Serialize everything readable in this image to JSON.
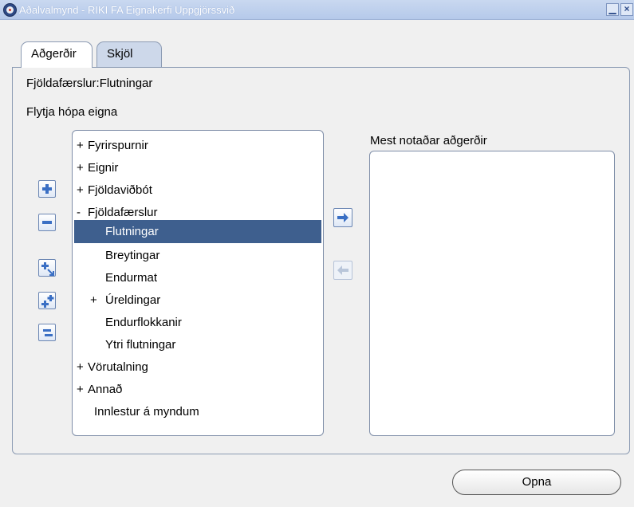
{
  "window": {
    "title": "Aðalvalmynd - RIKI FA Eignakerfi Uppgjörssvið",
    "minimize_glyph": "▁",
    "close_glyph": "×"
  },
  "tabs": [
    {
      "label": "Aðgerðir",
      "active": true
    },
    {
      "label": "Skjöl",
      "active": false
    }
  ],
  "path_label": "Fjöldafærslur:Flutningar",
  "section_label": "Flytja hópa eigna",
  "tree": {
    "items": [
      {
        "expander": "+",
        "label": "Fyrirspurnir",
        "level": 0
      },
      {
        "expander": "+",
        "label": "Eignir",
        "level": 0
      },
      {
        "expander": "+",
        "label": "Fjöldaviðbót",
        "level": 0
      },
      {
        "expander": "-",
        "label": "Fjöldafærslur",
        "level": 0
      },
      {
        "expander": "",
        "label": "Flutningar",
        "level": 1,
        "selected": true
      },
      {
        "expander": "",
        "label": "Breytingar",
        "level": 1
      },
      {
        "expander": "",
        "label": "Endurmat",
        "level": 1
      },
      {
        "expander": "+",
        "label": "Úreldingar",
        "level": 1
      },
      {
        "expander": "",
        "label": "Endurflokkanir",
        "level": 1
      },
      {
        "expander": "",
        "label": "Ytri flutningar",
        "level": 1
      },
      {
        "expander": "+",
        "label": "Vörutalning",
        "level": 0
      },
      {
        "expander": "+",
        "label": "Annað",
        "level": 0
      },
      {
        "expander": "",
        "label": "Innlestur á myndum",
        "level": 0
      }
    ]
  },
  "favorites": {
    "label": "Mest notaðar aðgerðir",
    "items": []
  },
  "buttons": {
    "open": "Opna"
  },
  "colors": {
    "selection": "#3e5f8e",
    "title_bar": "#b5c9ea",
    "tab_inactive": "#cdd8ea"
  }
}
